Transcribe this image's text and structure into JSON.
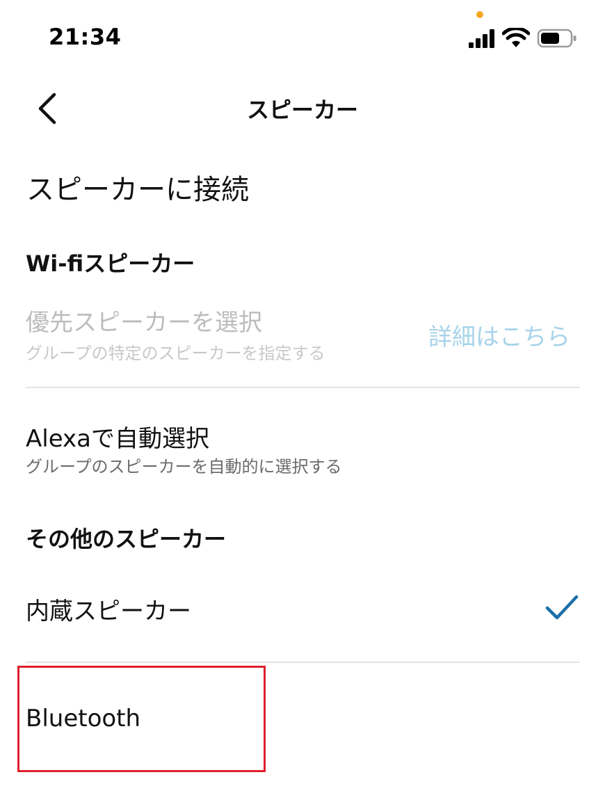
{
  "status_bar": {
    "time": "21:34",
    "privacy_dot_color": "#f5a623",
    "icons": [
      "signal-icon",
      "wifi-icon",
      "battery-icon"
    ]
  },
  "header": {
    "back_icon": "chevron-left-icon",
    "title": "スピーカー"
  },
  "main": {
    "section_title": "スピーカーに接続",
    "wifi_group": {
      "heading": "Wi-fiスピーカー",
      "preferred": {
        "title": "優先スピーカーを選択",
        "subtitle": "グループの特定のスピーカーを指定する",
        "link": "詳細はこちら",
        "enabled": false
      },
      "auto": {
        "title": "Alexaで自動選択",
        "subtitle": "グループのスピーカーを自動的に選択する"
      }
    },
    "other_group": {
      "heading": "その他のスピーカー",
      "builtin": {
        "title": "内蔵スピーカー",
        "selected": true
      },
      "bluetooth": {
        "title": "Bluetooth"
      }
    }
  },
  "colors": {
    "accent": "#1a6fa8",
    "link_disabled": "#a7d3ea",
    "highlight": "#e0202d",
    "divider": "#e3e3e3"
  }
}
